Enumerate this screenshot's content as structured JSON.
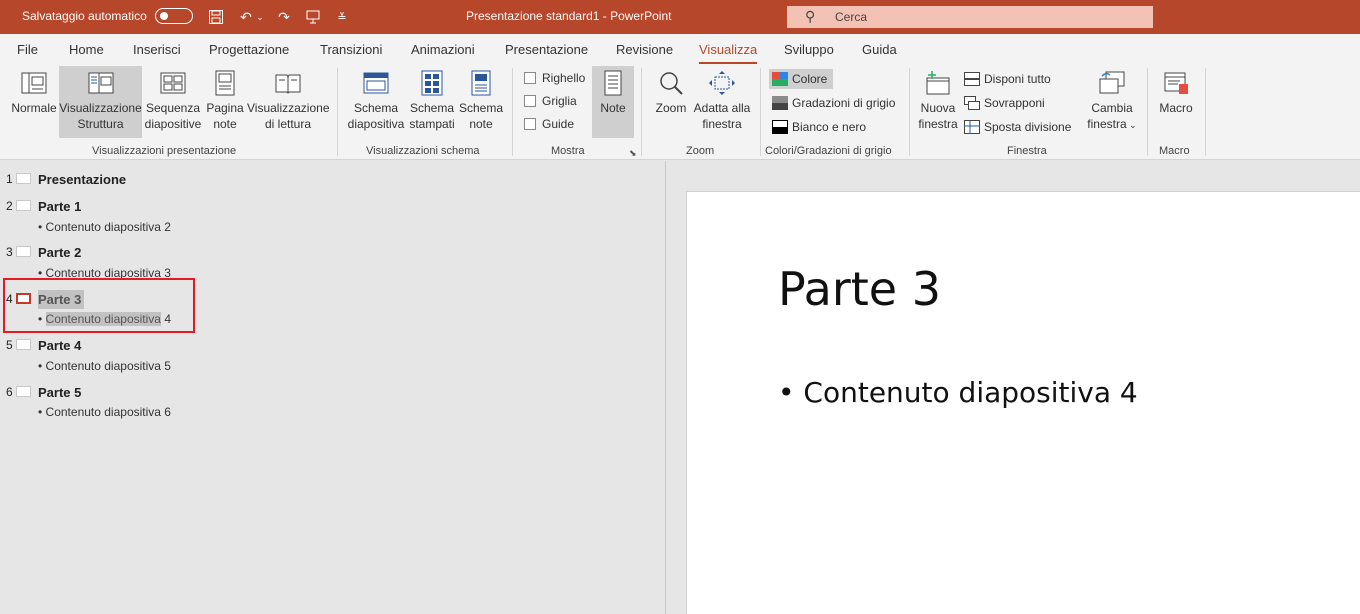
{
  "titlebar": {
    "autosave_label": "Salvataggio automatico",
    "document_title": "Presentazione standard1  -  PowerPoint",
    "search_placeholder": "Cerca",
    "accent_color": "#b7472a"
  },
  "tabs": [
    "File",
    "Home",
    "Inserisci",
    "Progettazione",
    "Transizioni",
    "Animazioni",
    "Presentazione",
    "Revisione",
    "Visualizza",
    "Sviluppo",
    "Guida"
  ],
  "active_tab": "Visualizza",
  "ribbon": {
    "presentation_views": {
      "group_label": "Visualizzazioni presentazione",
      "normal": "Normale",
      "outline_1": "Visualizzazione",
      "outline_2": "Struttura",
      "sorter_1": "Sequenza",
      "sorter_2": "diapositive",
      "notes_1": "Pagina",
      "notes_2": "note",
      "reading_1": "Visualizzazione",
      "reading_2": "di lettura"
    },
    "master_views": {
      "group_label": "Visualizzazioni schema",
      "slide_master_1": "Schema",
      "slide_master_2": "diapositiva",
      "handout_master_1": "Schema",
      "handout_master_2": "stampati",
      "notes_master_1": "Schema",
      "notes_master_2": "note"
    },
    "show": {
      "group_label": "Mostra",
      "ruler": "Righello",
      "gridlines": "Griglia",
      "guides": "Guide",
      "notes": "Note"
    },
    "zoom": {
      "group_label": "Zoom",
      "zoom": "Zoom",
      "fit_1": "Adatta alla",
      "fit_2": "finestra"
    },
    "color": {
      "group_label": "Colori/Gradazioni di grigio",
      "color": "Colore",
      "grayscale": "Gradazioni di grigio",
      "bw": "Bianco e nero"
    },
    "window": {
      "group_label": "Finestra",
      "new_1": "Nuova",
      "new_2": "finestra",
      "arrange_all": "Disponi tutto",
      "cascade": "Sovrapponi",
      "move_split": "Sposta divisione",
      "switch_1": "Cambia",
      "switch_2": "finestra"
    },
    "macros": {
      "group_label": "Macro",
      "macro": "Macro"
    }
  },
  "outline": [
    {
      "num": "1",
      "title": "Presentazione",
      "bullet": ""
    },
    {
      "num": "2",
      "title": "Parte 1",
      "bullet": "Contenuto diapositiva 2"
    },
    {
      "num": "3",
      "title": "Parte 2",
      "bullet": "Contenuto diapositiva 3"
    },
    {
      "num": "4",
      "title": "Parte 3",
      "bullet_selected": "Contenuto diapositiva",
      "bullet_rest": "4"
    },
    {
      "num": "5",
      "title": "Parte 4",
      "bullet": "Contenuto diapositiva 5"
    },
    {
      "num": "6",
      "title": "Parte 5",
      "bullet": "Contenuto diapositiva 6"
    }
  ],
  "slide_preview": {
    "title": "Parte 3",
    "bullet": "Contenuto diapositiva 4"
  }
}
